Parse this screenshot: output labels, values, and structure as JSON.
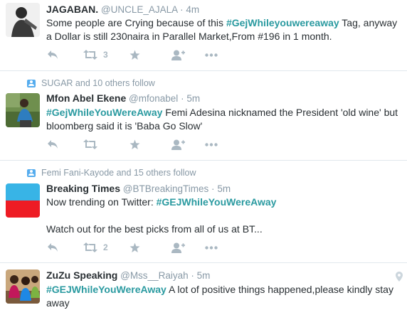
{
  "tweets": [
    {
      "fullname": "JAGABAN.",
      "handle": "@UNCLE_AJALA",
      "dot": "·",
      "time": "4m",
      "text_before": "Some people are Crying because of this ",
      "hashtag": "#GejWhileyouwereaway",
      "text_after": " Tag, anyway a Dollar is still 230naira in Parallel Market,From #196 in 1 month.",
      "retweet_count": "3"
    },
    {
      "social_context": "SUGAR and 10 others follow",
      "fullname": "Mfon Abel Ekene",
      "handle": "@mfonabel",
      "dot": "·",
      "time": "5m",
      "hashtag": "#GejWhileYouWereAway",
      "text_after": " Femi Adesina nicknamed the President 'old wine' but bloomberg said it is 'Baba Go Slow'"
    },
    {
      "social_context": "Femi Fani-Kayode and 15 others follow",
      "fullname": "Breaking Times",
      "handle": "@BTBreakingTimes",
      "dot": "·",
      "time": "5m",
      "text_before": "Now trending on Twitter: ",
      "hashtag": "#GEJWhileYouWereAway",
      "text_line2": "Watch out for the best picks from all of us at BT...",
      "retweet_count": "2"
    },
    {
      "fullname": "ZuZu Speaking",
      "handle": "@Mss__Raiyah",
      "dot": "·",
      "time": "5m",
      "hashtag": "#GEJWhileYouWereAway",
      "text_after": " A lot of positive things happened,please kindly stay away"
    }
  ],
  "colors": {
    "hashtag": "#2a9aa0",
    "muted": "#8899a6",
    "action_icon": "#aab8c2",
    "social_icon": "#55acee"
  },
  "icons": [
    "reply-icon",
    "retweet-icon",
    "favorite-icon",
    "follow-icon",
    "more-icon",
    "location-pin-icon",
    "social-context-icon"
  ]
}
